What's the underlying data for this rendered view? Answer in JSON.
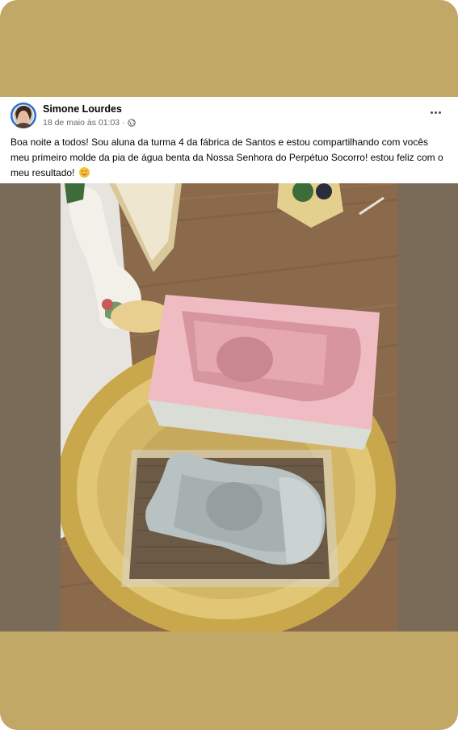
{
  "post": {
    "author": "Simone Lourdes",
    "date": "18 de maio às 01:03",
    "separator": "·",
    "privacy_icon": "globe-icon",
    "more_icon": "more-options-icon",
    "text": "Boa noite a todos! Sou aluna da turma 4 da fábrica de Santos e estou compartilhando com vocês meu primeiro molde da pia de água benta da Nossa Senhora do Perpétuo Socorro! estou feliz com o meu resultado!",
    "emoji_icon": "smiling-face-icon"
  },
  "colors": {
    "frame_background": "#c2a867",
    "photo_side_background": "#7a6a58",
    "text_primary": "#050505",
    "text_secondary": "#65676b",
    "avatar_ring": "#2d6fd0"
  }
}
